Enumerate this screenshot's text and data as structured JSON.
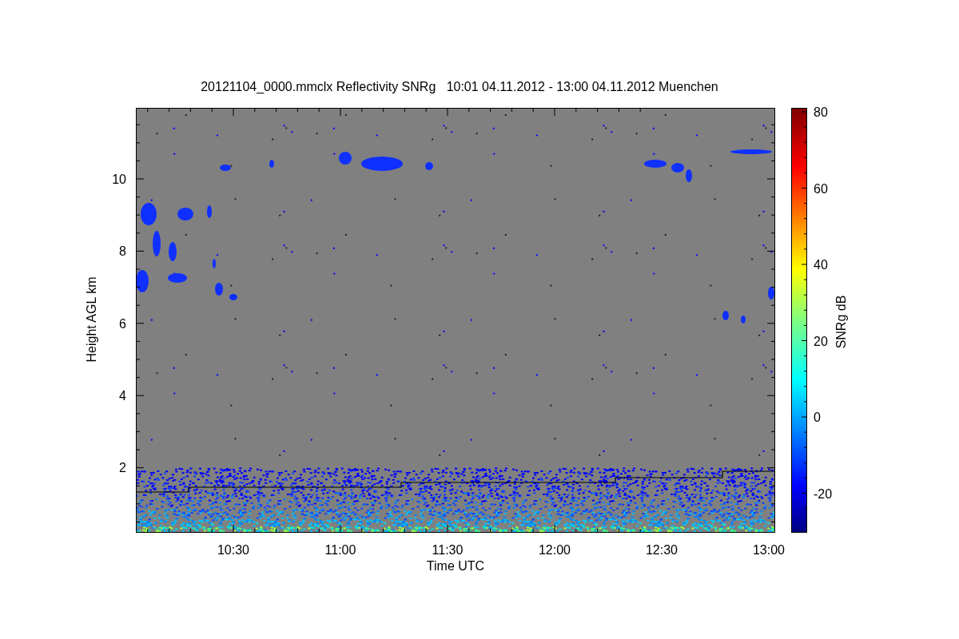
{
  "title": "20121104_0000.mmclx Reflectivity SNRg   10:01 04.11.2012 - 13:00 04.11.2012 Muenchen",
  "plot": {
    "ylabel": "Height AGL km",
    "xlabel": "Time UTC",
    "yticks": [
      "10",
      "8",
      "6",
      "4",
      "2"
    ],
    "xticks": [
      "10:30",
      "11:00",
      "11:30",
      "12:00",
      "12:30",
      "13:00"
    ]
  },
  "colorbar": {
    "label": "SNRg dB",
    "ticks": [
      "80",
      "60",
      "40",
      "20",
      "0",
      "-20"
    ]
  }
}
